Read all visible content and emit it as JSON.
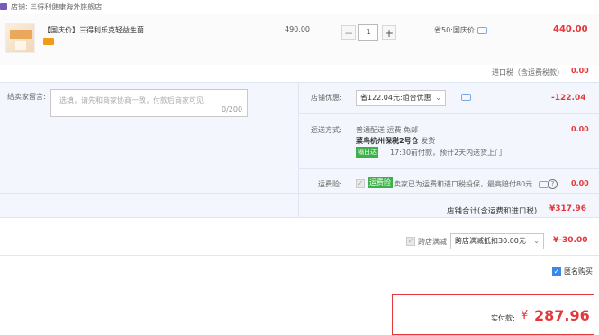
{
  "shop": {
    "label": "店铺: 三得利健康海外旗舰店",
    "icon": "shop-icon"
  },
  "product": {
    "title": "【国庆价】三得利乐克轻益生菌...",
    "price": "490.00",
    "quantity": "1",
    "discount_text": "省50:国庆价",
    "subtotal": "440.00",
    "minus_label": "−",
    "plus_label": "+"
  },
  "import_tax": {
    "label": "进口税（含运费税款）",
    "value": "0.00"
  },
  "message": {
    "label": "给卖家留言:",
    "placeholder": "选填，请先和商家协商一致，付款后商家可见",
    "counter": "0/200"
  },
  "shop_discount": {
    "label": "店铺优惠:",
    "selected": "省122.04元:组合优惠",
    "value": "-122.04"
  },
  "shipping": {
    "label": "运送方式:",
    "line1": "普通配送 运费 免邮",
    "line2_bold": "菜鸟杭州保税2号仓",
    "line2_rest": " 发货",
    "badge": "隔日达",
    "line3": "17:30前付款，预计2天内送货上门",
    "value": "0.00"
  },
  "insurance": {
    "label": "运费险:",
    "tag": "运费险",
    "text": "卖家已为运费和进口税投保，最高赔付80元",
    "value": "0.00"
  },
  "shop_total": {
    "label": "店铺合计(含运费和进口税)",
    "value": "¥317.96"
  },
  "cross_store": {
    "label": "跨店满减",
    "selected": "跨店满减抵扣30.00元",
    "value": "¥-30.00"
  },
  "anonymous": {
    "label": "匿名购买"
  },
  "pay": {
    "label": "实付款:",
    "currency": "¥",
    "amount": "287.96"
  },
  "colors": {
    "accent": "#e4393c",
    "blue": "#3c88e8",
    "row_bg": "#f3f7fd",
    "green": "#3cb14a"
  }
}
